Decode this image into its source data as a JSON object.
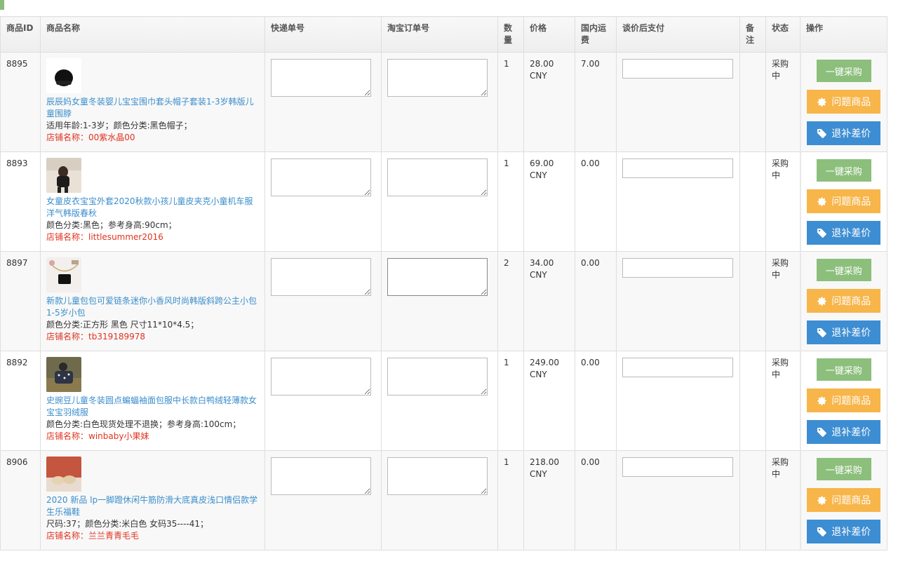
{
  "headers": [
    "商品ID",
    "商品名称",
    "快递单号",
    "淘宝订单号",
    "数量",
    "价格",
    "国内运费",
    "谈价后支付",
    "备注",
    "状态",
    "操作"
  ],
  "buttons": {
    "purchase": "一键采购",
    "problem": "问题商品",
    "refund": "退补差价"
  },
  "shop_prefix": "店铺名称：",
  "rows": [
    {
      "id": "8895",
      "name": "辰辰妈女童冬装婴儿宝宝围巾套头帽子套装1-3岁韩版儿童围脖",
      "attrs": "适用年龄:1-3岁；颜色分类:黑色帽子；",
      "shop": "00紫水晶00",
      "qty": "1",
      "price": "28.00 CNY",
      "shipping": "7.00",
      "status": "采购中",
      "note": ""
    },
    {
      "id": "8893",
      "name": "女童皮衣宝宝外套2020秋款小孩儿童皮夹克小童机车服洋气韩版春秋",
      "attrs": "颜色分类:黑色；参考身高:90cm；",
      "shop": "littlesummer2016",
      "qty": "1",
      "price": "69.00 CNY",
      "shipping": "0.00",
      "status": "采购中",
      "note": ""
    },
    {
      "id": "8897",
      "name": "新款儿童包包可爱链条迷你小香风时尚韩版斜跨公主小包1-5岁小包",
      "attrs": "颜色分类:正方形 黑色 尺寸11*10*4.5；",
      "shop": "tb319189978",
      "qty": "2",
      "price": "34.00 CNY",
      "shipping": "0.00",
      "status": "采购中",
      "note": ""
    },
    {
      "id": "8892",
      "name": "史豌豆儿童冬装圆点蝙蝠袖面包服中长款白鸭绒轻薄款女宝宝羽绒服",
      "attrs": "颜色分类:白色现货处理不退换；参考身高:100cm；",
      "shop": "winbaby小果妹",
      "qty": "1",
      "price": "249.00 CNY",
      "shipping": "0.00",
      "status": "采购中",
      "note": ""
    },
    {
      "id": "8906",
      "name": "2020 新品 lp一脚蹬休闲牛筋防滑大底真皮浅口情侣款学生乐福鞋",
      "attrs": "尺码:37；颜色分类:米白色 女码35----41；",
      "shop": "兰兰青青毛毛",
      "qty": "1",
      "price": "218.00 CNY",
      "shipping": "0.00",
      "status": "采购中",
      "note": ""
    }
  ],
  "icons": {
    "problem": "gear-icon",
    "refund": "tag-icon"
  }
}
